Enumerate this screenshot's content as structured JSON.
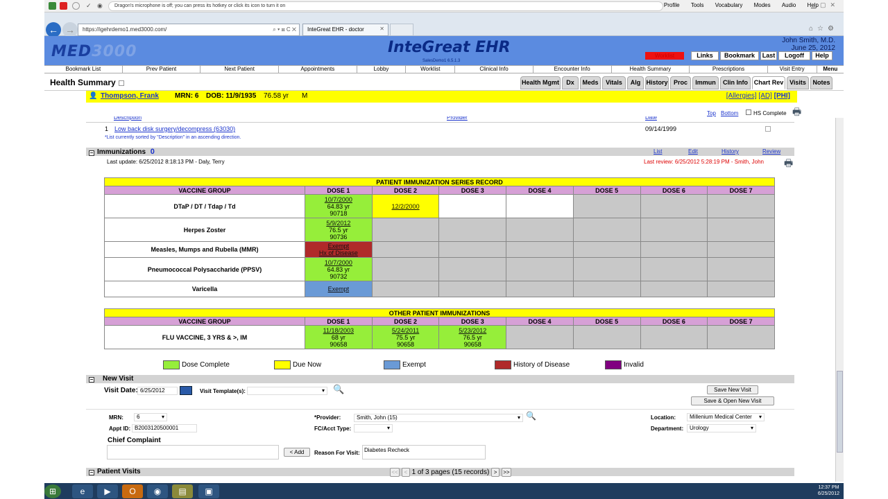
{
  "dragon": {
    "message": "Dragon's microphone is off; you can press its hotkey or click its icon to turn it on",
    "menu": [
      "Profile",
      "Tools",
      "Vocabulary",
      "Modes",
      "Audio",
      "Help"
    ]
  },
  "browser": {
    "address": "https://igehrdemo1.med3000.com/",
    "tab": "InteGreat EHR - doctor"
  },
  "header": {
    "logo": "MED3000",
    "logo_a": "MED",
    "logo_b": "3000",
    "title": "InteGreat EHR",
    "subtitle": "SalesDemo1 6.5.1.3",
    "user": "John Smith, M.D.",
    "date": "June 25, 2012",
    "worklist": "Worklist",
    "links": "Links",
    "bookmark": "Bookmark",
    "last": "Last",
    "logoff": "Logoff",
    "help": "Help"
  },
  "nav": [
    "Bookmark List",
    "Prev Patient",
    "Next Patient",
    "Appointments",
    "Lobby",
    "Worklist",
    "Clinical Info",
    "Encounter Info",
    "Health Summary",
    "Prescriptions",
    "Visit Entry",
    "Menu"
  ],
  "page": {
    "title": "Health Summary"
  },
  "tabs": [
    "Health Mgmt",
    "Dx",
    "Meds",
    "Vitals",
    "Alg",
    "History",
    "Proc",
    "Immun",
    "Clin Info",
    "Chart Rev",
    "Visits",
    "Notes"
  ],
  "patient": {
    "name": "Thompson, Frank",
    "mrn": "MRN: 6",
    "dob": "DOB: 11/9/1935",
    "age": "76.58 yr",
    "sex": "M",
    "allergies": "[Allergies]",
    "ad": "[AD]",
    "phi": "[PHI]"
  },
  "procedures": {
    "col_desc": "Description",
    "col_provider": "Provider",
    "col_date": "Date",
    "top": "Top",
    "bottom": "Bottom",
    "hs_complete": "HS Complete",
    "row_num": "1",
    "row_desc": "Low back disk surgery/decompress (63030)",
    "row_date": "09/14/1999",
    "sort_note": "*List currently sorted by \"Description\" in an ascending direction."
  },
  "immunizations": {
    "title": "Immunizations",
    "count": "0",
    "list": "List",
    "edit": "Edit",
    "history": "History",
    "review": "Review",
    "last_update": "Last update: 6/25/2012 8:18:13 PM - Daly, Terry",
    "last_review": "Last review: 6/25/2012 5:28:19 PM - Smith, John",
    "series_title": "PATIENT IMMUNIZATION SERIES RECORD",
    "other_title": "OTHER PATIENT IMMUNIZATIONS",
    "columns": [
      "VACCINE GROUP",
      "DOSE 1",
      "DOSE 2",
      "DOSE 3",
      "DOSE 4",
      "DOSE 5",
      "DOSE 6",
      "DOSE 7"
    ],
    "series": [
      {
        "name": "DTaP / DT / Tdap / Td",
        "d1": [
          "10/7/2000",
          "64.83 yr",
          "90718"
        ],
        "d2": "12/2/2000"
      },
      {
        "name": "Herpes Zoster",
        "d1": [
          "5/9/2012",
          "76.5 yr",
          "90736"
        ]
      },
      {
        "name": "Measles, Mumps and Rubella (MMR)",
        "d1": [
          "Exempt",
          "Hx of Disease"
        ]
      },
      {
        "name": "Pneumococcal Polysaccharide (PPSV)",
        "d1": [
          "10/7/2000",
          "64.83 yr",
          "90732"
        ]
      },
      {
        "name": "Varicella",
        "d1": "Exempt"
      }
    ],
    "other": [
      {
        "name": "FLU VACCINE, 3 YRS & >, IM",
        "d1": [
          "11/18/2003",
          "68 yr",
          "90658"
        ],
        "d2": [
          "5/24/2011",
          "75.5 yr",
          "90658"
        ],
        "d3": [
          "5/23/2012",
          "76.5 yr",
          "90658"
        ]
      }
    ]
  },
  "legend": [
    {
      "label": "Dose Complete",
      "color": "#96ee3a"
    },
    {
      "label": "Due Now",
      "color": "#ffff00"
    },
    {
      "label": "Exempt",
      "color": "#6a9ad6"
    },
    {
      "label": "History of Disease",
      "color": "#b02a2a"
    },
    {
      "label": "Invalid",
      "color": "#800080"
    }
  ],
  "new_visit": {
    "title": "New Visit",
    "visit_date_label": "Visit Date:",
    "visit_date": "6/25/2012",
    "template_label": "Visit Template(s):",
    "save": "Save New Visit",
    "save_open": "Save & Open New Visit",
    "mrn_label": "MRN:",
    "mrn": "6",
    "appt_label": "Appt ID:",
    "appt": "B2003120500001",
    "provider_label": "*Provider:",
    "provider": "Smith, John (15)",
    "fc_label": "FC/Acct Type:",
    "location_label": "Location:",
    "location": "Millenium Medical Center",
    "dept_label": "Department:",
    "dept": "Urology",
    "cc_label": "Chief Complaint",
    "add": "< Add",
    "reason_label": "Reason For Visit:",
    "reason": "Diabetes Recheck"
  },
  "patient_visits": {
    "title": "Patient Visits",
    "pager": "1 of 3 pages (15 records)",
    "first": "<<",
    "prev": "<",
    "next": ">",
    "last": ">>"
  },
  "taskbar": {
    "time": "12:37 PM",
    "date": "6/25/2012"
  }
}
